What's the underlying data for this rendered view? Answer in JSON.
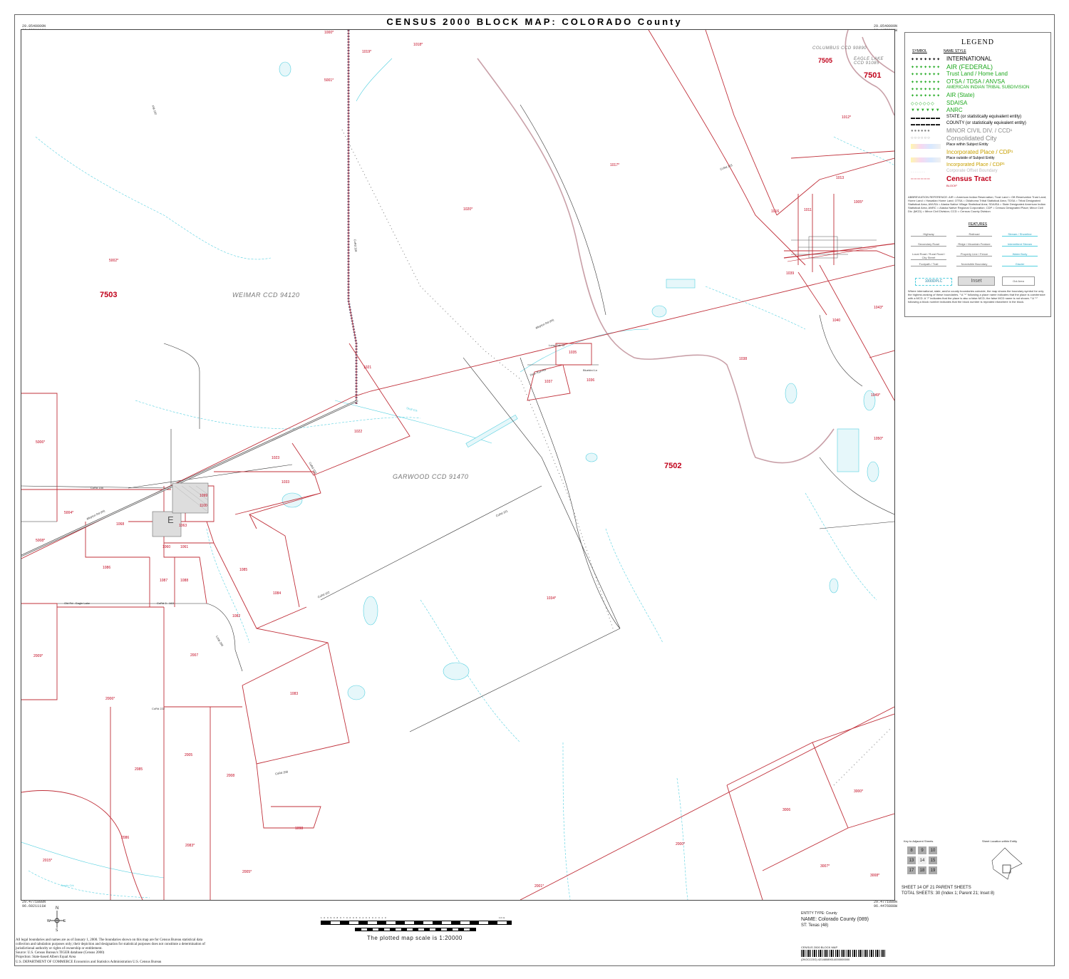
{
  "title": "CENSUS 2000 BLOCK MAP: COLORADO County",
  "corners": {
    "top_left": "29.8540009N\n96.6021111W",
    "top_right": "29.8540009N\n96.4476888W",
    "bottom_left": "29.4771888N\n96.6021111W",
    "bottom_right": "29.4771888N\n96.4476888W"
  },
  "tracts": [
    "7503",
    "7502",
    "7505",
    "7501"
  ],
  "ccds": [
    "WEIMAR CCD 94120",
    "GARWOOD CCD 91470",
    "COLUMBUS CCD 90890",
    "EAGLE LAKE CCD 91085"
  ],
  "blocks": [
    "1000*",
    "1019*",
    "1018*",
    "5001*",
    "1012*",
    "1017*",
    "1020*",
    "1013",
    "1005*",
    "1016",
    "1011",
    "5002*",
    "1021",
    "1022",
    "1023",
    "1033",
    "1035",
    "1037",
    "1036",
    "1038",
    "1040",
    "1043*",
    "1049*",
    "1050*",
    "1039",
    "5006*",
    "5004*",
    "5008*",
    "1068",
    "1063",
    "1060",
    "1061",
    "1084",
    "1085",
    "1086",
    "1087",
    "1088",
    "1082",
    "1034*",
    "1083",
    "2007",
    "2006*",
    "2005",
    "2008",
    "2009*",
    "2085",
    "2086",
    "2015*",
    "2083*",
    "2001*",
    "2005*",
    "3006",
    "3000*",
    "2000*",
    "3007*",
    "3008*",
    "1098",
    "1099",
    "1100"
  ],
  "roads": [
    "Alleyton Rd (IH)",
    "Alleyton Rd (IH)",
    "CoRd 155",
    "CoRd 101",
    "CoRd 102",
    "CoRd 103",
    "CoRd 118",
    "FM 102",
    "CoRd 3 - 163",
    "Old Rd - Eagle Lake",
    "Loop 206",
    "CoRd 222",
    "CoRd 208",
    "CoRd 103",
    "Long Oak Dr",
    "Deer Run Rd",
    "Bluebird Ln",
    "Sandy Crk",
    "Skull Crk"
  ],
  "legend": {
    "heading": "LEGEND",
    "symbol_label": "SYMBOL",
    "name_style_label": "NAME STYLE",
    "items": [
      {
        "sym": "✦✦✦✦✦✦✦",
        "name": "INTERNATIONAL",
        "color": "#000000"
      },
      {
        "sym": "✦✦✦✦✦✦✦",
        "name": "AIR (FEDERAL)",
        "color": "#1ea81e"
      },
      {
        "sym": "✦✦✦✦✦✦✦",
        "name": "Trust Land / Home Land",
        "color": "#1ea81e"
      },
      {
        "sym": "✦✦✦✦✦✦✦",
        "name": "OTSA / TDSA / ANVSA",
        "color": "#1ea81e"
      },
      {
        "sym": "✦✦✦✦✦✦✦",
        "name": "AMERICAN INDIAN TRIBAL SUBDIVISION",
        "color": "#1ea81e"
      },
      {
        "sym": "✦✦✦✦✦✦✦",
        "name": "AIR (State)",
        "color": "#1ea81e"
      },
      {
        "sym": "◇◇◇◇◇◇",
        "name": "SDAISA",
        "color": "#1ea81e"
      },
      {
        "sym": "▼▼▼▼▼▼",
        "name": "ANRC",
        "color": "#1ea81e"
      },
      {
        "sym": "▬▬▬▬▬▬",
        "name": "STATE (or statistically equivalent entity)",
        "color": "#000000"
      },
      {
        "sym": "▬▬▬▬▬▬",
        "name": "COUNTY (or statistically equivalent entity)",
        "color": "#000000"
      },
      {
        "sym": "●●●●●●",
        "name": "MINOR CIVIL DIV. / CCD¹",
        "color": "#888888"
      },
      {
        "sym": "○○○○○○",
        "name": "Consolidated City",
        "color": "#888888"
      },
      {
        "sym": "",
        "name": "Place within Subject Entity",
        "color": "#000000"
      },
      {
        "sym": "",
        "name": "Incorporated Place / CDP¹",
        "color": "#c8a000"
      },
      {
        "sym": "",
        "name": "Place outside of Subject Entity",
        "color": "#000000"
      },
      {
        "sym": "",
        "name": "Incorporated Place / CDP¹",
        "color": "#c8a000"
      },
      {
        "sym": "·······",
        "name": "Corporate Offset Boundary",
        "color": "#bbbbbb"
      },
      {
        "sym": "━━━━━━",
        "name": "Census Tract",
        "color": "#c0001a"
      },
      {
        "sym": "",
        "name": "BLOCK²",
        "color": "#c0001a"
      }
    ],
    "abbreviations": "ABBREVIATION REFERENCE: AIR = American Indian Reservation; Trust Land = Off-Reservation Trust Land; Home Land = Hawaiian Home Land; OTSA = Oklahoma Tribal Statistical Area; TDSA = Tribal Designated Statistical Area; ANVSA = Alaska Native Village Statistical Area; SDAISA = State Designated American Indian Statistical Area; ANRC = Alaska Native Regional Corporation; CDP = Census Designated Place; Minor Civil Div. (MCD) = Minor Civil Division; CCD = Census County Division",
    "features_heading": "FEATURES",
    "features": [
      "Highway",
      "Railroad",
      "Stream / Shoreline",
      "Secondary Road",
      "Ridge / Mountain Feature",
      "Intermittent Stream",
      "Local Road / Rural Road / City Street",
      "Property Line / Fence",
      "Water Body",
      "Footpath / Trail",
      "Nonvisible Boundary",
      "Glacier"
    ],
    "inset_labels": [
      "1000DPLC",
      "Inset",
      "Out Area"
    ],
    "notes": "Where international, state, and/or county boundaries coincide, the map shows the boundary symbol for only the highest-ranking of these boundaries. ¹ A \"*\" following a place name indicates that the place is coextensive with a MCD. A \"/\" indicates that the place is also a false MCD; the false MCD name is not shown. ² A \"*\" following a block number indicates that the block number is repeated elsewhere in the block."
  },
  "key_sheets": {
    "title": "Key to Adjacent Sheets",
    "cells": [
      "8",
      "9",
      "10",
      "13",
      "14",
      "15",
      "17",
      "18",
      "19"
    ],
    "location_title": "Sheet Location within Entity"
  },
  "sheet_info": {
    "sheet": "SHEET 14 OF 21 PARENT SHEETS",
    "total": "TOTAL SHEETS: 30 (Index 1; Parent 21; Inset 8)"
  },
  "entity": {
    "type": "ENTITY TYPE: County",
    "name": "NAME: Colorado County (089)",
    "state": "ST: Texas (48)"
  },
  "scale": {
    "text": "The plotted map scale is 1:20000",
    "top_ticks": "1.0  0.9  0.8  0.7  0.6  0.5  0.4  0.3  0.2  0.1  0",
    "top_unit": "1.0 mi",
    "bottom_unit": "1 km"
  },
  "footer": {
    "disclaimer": "All legal boundaries and names are as of January 1, 2000. The boundaries shown on this map are for Census Bureau statistical data collection and tabulation purposes only; their depiction and designation for statistical purposes does not constitute a determination of jurisdictional authority or rights of ownership or entitlement.",
    "source": "Source:  U.S. Census Bureau's TIGER database (Census 2000)",
    "projection": "Projection:  State-based Albers Equal Area",
    "dept": "U.S. DEPARTMENT OF COMMERCE Economics and Statistics Administration  U.S. Census Bureau",
    "barcode_label": "CENSUS 2000 BLOCK MAP",
    "barcode_code": "(2KGCCOO) 42148089014000000000"
  },
  "compass": {
    "n": "N",
    "s": "S",
    "e": "E",
    "w": "W"
  },
  "inset_letter": "E"
}
